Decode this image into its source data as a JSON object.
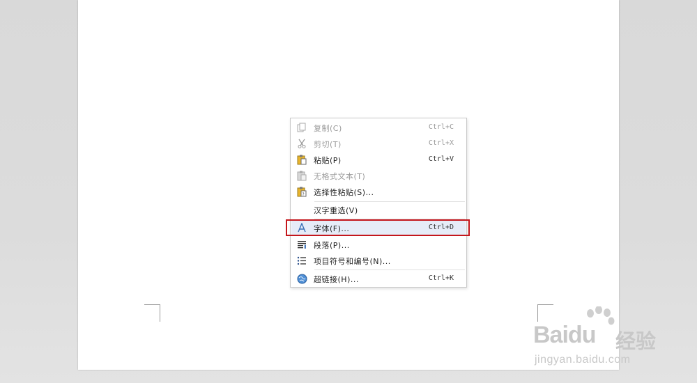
{
  "context_menu": {
    "items": [
      {
        "label": "复制(C)",
        "shortcut": "Ctrl+C",
        "icon": "copy-icon",
        "enabled": false
      },
      {
        "label": "剪切(T)",
        "shortcut": "Ctrl+X",
        "icon": "scissors-icon",
        "enabled": false
      },
      {
        "label": "粘贴(P)",
        "shortcut": "Ctrl+V",
        "icon": "paste-icon",
        "enabled": true
      },
      {
        "label": "无格式文本(T)",
        "shortcut": "",
        "icon": "paste-plain-text-icon",
        "enabled": false
      },
      {
        "label": "选择性粘贴(S)...",
        "shortcut": "",
        "icon": "paste-special-icon",
        "enabled": true
      },
      {
        "label": "汉字重选(V)",
        "shortcut": "",
        "icon": "",
        "enabled": true
      },
      {
        "label": "字体(F)...",
        "shortcut": "Ctrl+D",
        "icon": "font-icon",
        "enabled": true,
        "highlighted": true
      },
      {
        "label": "段落(P)...",
        "shortcut": "",
        "icon": "paragraph-icon",
        "enabled": true
      },
      {
        "label": "项目符号和编号(N)...",
        "shortcut": "",
        "icon": "bullet-list-icon",
        "enabled": true
      },
      {
        "label": "超链接(H)...",
        "shortcut": "Ctrl+K",
        "icon": "hyperlink-globe-icon",
        "enabled": true
      }
    ]
  },
  "watermark": {
    "brand": "Bai",
    "brand_suffix": "du",
    "product": "经验",
    "url": "jingyan.baidu.com"
  },
  "colors": {
    "highlight_box": "#c4161c",
    "menu_highlight": "#e6ecf8",
    "disabled_text": "#9a9a9a"
  }
}
